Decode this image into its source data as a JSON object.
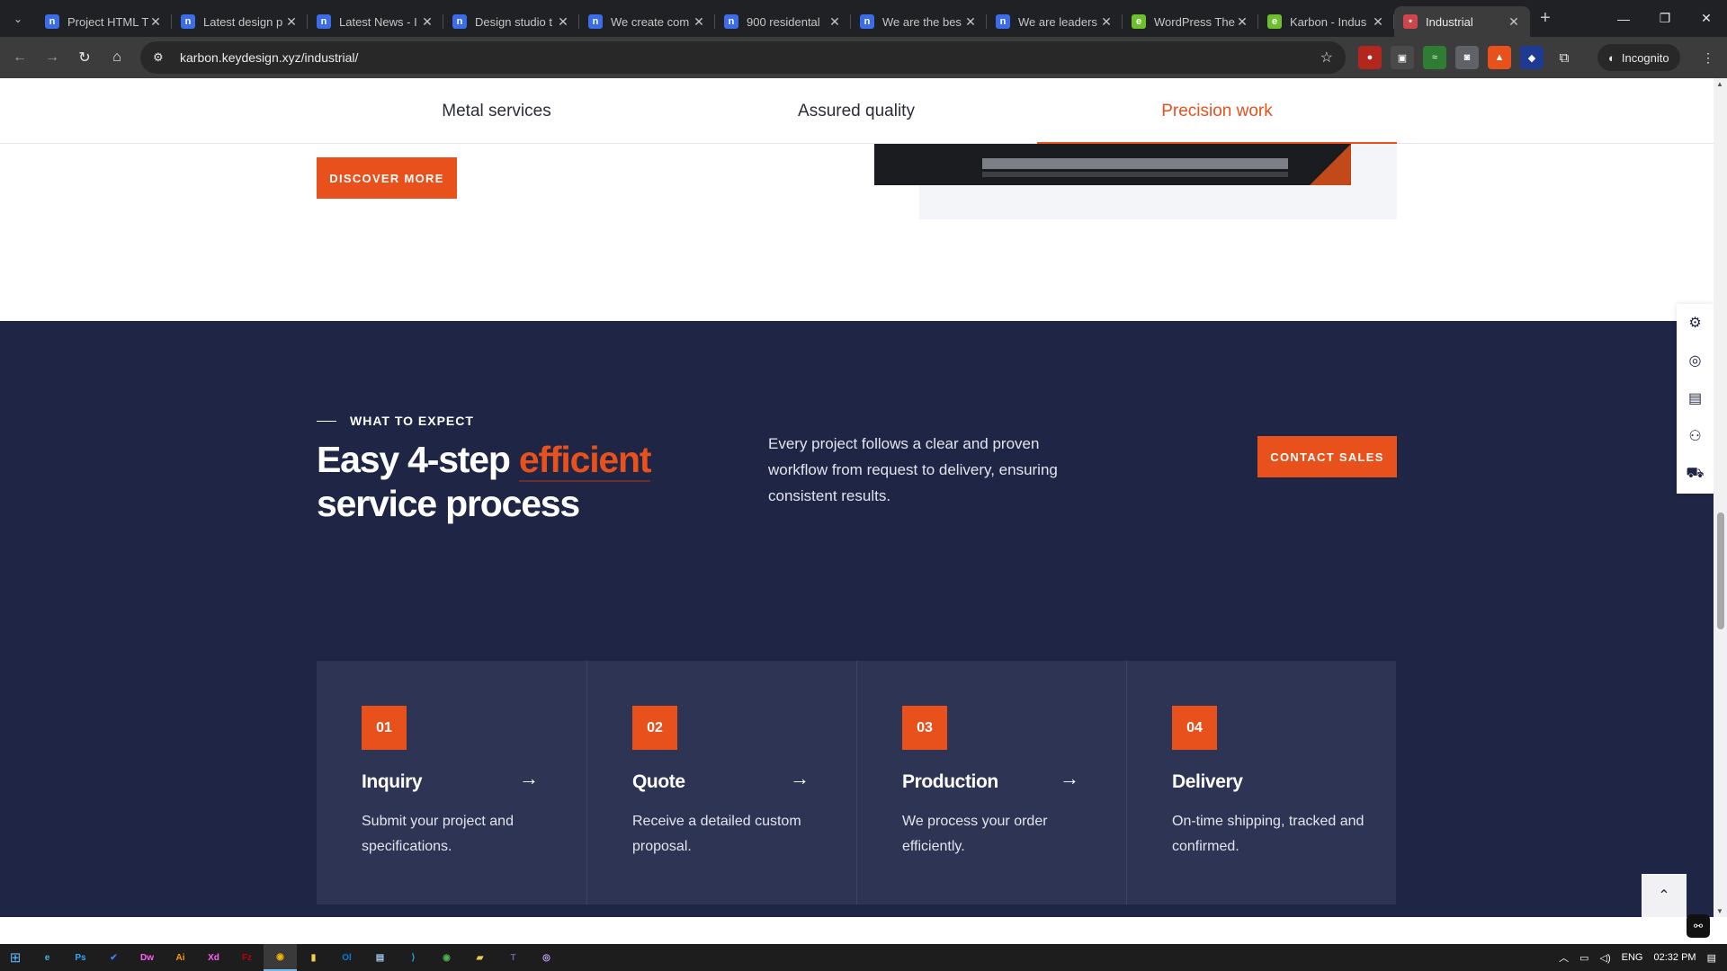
{
  "browser": {
    "tabs": [
      {
        "title": "Project HTML T",
        "icon": "notion-n-icon",
        "color": "#3d6ce8",
        "glyph": "n"
      },
      {
        "title": "Latest design p",
        "icon": "notion-n-icon",
        "color": "#3d6ce8",
        "glyph": "n"
      },
      {
        "title": "Latest News - I",
        "icon": "notion-n-icon",
        "color": "#3d6ce8",
        "glyph": "n"
      },
      {
        "title": "Design studio t",
        "icon": "notion-n-icon",
        "color": "#3d6ce8",
        "glyph": "n"
      },
      {
        "title": "We create com",
        "icon": "notion-n-icon",
        "color": "#3d6ce8",
        "glyph": "n"
      },
      {
        "title": "900 residental",
        "icon": "notion-n-icon",
        "color": "#3d6ce8",
        "glyph": "n"
      },
      {
        "title": "We are the bes",
        "icon": "notion-n-icon",
        "color": "#3d6ce8",
        "glyph": "n"
      },
      {
        "title": "We are leaders",
        "icon": "notion-n-icon",
        "color": "#3d6ce8",
        "glyph": "n"
      },
      {
        "title": "WordPress The",
        "icon": "envato-leaf-icon",
        "color": "#6dbf2e",
        "glyph": "e"
      },
      {
        "title": "Karbon - Indus",
        "icon": "envato-leaf-icon",
        "color": "#6dbf2e",
        "glyph": "e"
      },
      {
        "title": "Industrial",
        "icon": "karbon-dot-icon",
        "color": "#d0454c",
        "glyph": "•",
        "active": true
      }
    ],
    "url": "karbon.keydesign.xyz/industrial/",
    "incognito_label": "Incognito"
  },
  "subnav": {
    "items": [
      "Metal services",
      "Assured quality",
      "Precision work"
    ],
    "active": "Precision work"
  },
  "top_section": {
    "discover_label": "DISCOVER MORE"
  },
  "process": {
    "eyebrow": "WHAT TO EXPECT",
    "headline_part1": "Easy 4-step",
    "headline_highlight": "efficient",
    "headline_part2": "service process",
    "lead": "Every project follows a clear and proven workflow from request to delivery, ensuring consistent results.",
    "contact_label": "CONTACT SALES",
    "steps": [
      {
        "num": "01",
        "title": "Inquiry",
        "desc": "Submit your project and specifications.",
        "has_arrow": true
      },
      {
        "num": "02",
        "title": "Quote",
        "desc": "Receive a detailed custom proposal.",
        "has_arrow": true
      },
      {
        "num": "03",
        "title": "Production",
        "desc": "We process your order efficiently.",
        "has_arrow": true
      },
      {
        "num": "04",
        "title": "Delivery",
        "desc": "On-time shipping, tracked and confirmed.",
        "has_arrow": false
      }
    ],
    "accent_color": "#e8501c",
    "background_color": "#1e2545"
  },
  "side_tools": [
    "gear-icon",
    "support-icon",
    "document-icon",
    "users-icon",
    "cart-icon"
  ],
  "taskbar": {
    "apps": [
      {
        "name": "edge-icon",
        "glyph": "e",
        "color": "#3fb6e8"
      },
      {
        "name": "photoshop-icon",
        "glyph": "Ps",
        "color": "#31a8ff"
      },
      {
        "name": "todo-icon",
        "glyph": "✔",
        "color": "#3b82f6"
      },
      {
        "name": "dreamweaver-icon",
        "glyph": "Dw",
        "color": "#ff61f6"
      },
      {
        "name": "illustrator-icon",
        "glyph": "Ai",
        "color": "#ff9a00"
      },
      {
        "name": "xd-icon",
        "glyph": "Xd",
        "color": "#ff61f6"
      },
      {
        "name": "filezilla-icon",
        "glyph": "Fz",
        "color": "#bf0000"
      },
      {
        "name": "chrome-icon",
        "glyph": "◉",
        "color": "#f2b705",
        "active": true
      },
      {
        "name": "sticky-notes-icon",
        "glyph": "▮",
        "color": "#f6d04d"
      },
      {
        "name": "outlook-icon",
        "glyph": "Ol",
        "color": "#0f78d4"
      },
      {
        "name": "notepad-icon",
        "glyph": "▤",
        "color": "#9fc7e8"
      },
      {
        "name": "vscode-icon",
        "glyph": "⟩",
        "color": "#23a9f2"
      },
      {
        "name": "chrome-icon-2",
        "glyph": "◉",
        "color": "#4caf50"
      },
      {
        "name": "file-explorer-icon",
        "glyph": "▰",
        "color": "#f2c94c"
      },
      {
        "name": "teams-icon",
        "glyph": "T",
        "color": "#6264a7"
      },
      {
        "name": "github-icon",
        "glyph": "◎",
        "color": "#c9a6ff"
      }
    ],
    "language": "ENG",
    "time": "02:32 PM"
  }
}
